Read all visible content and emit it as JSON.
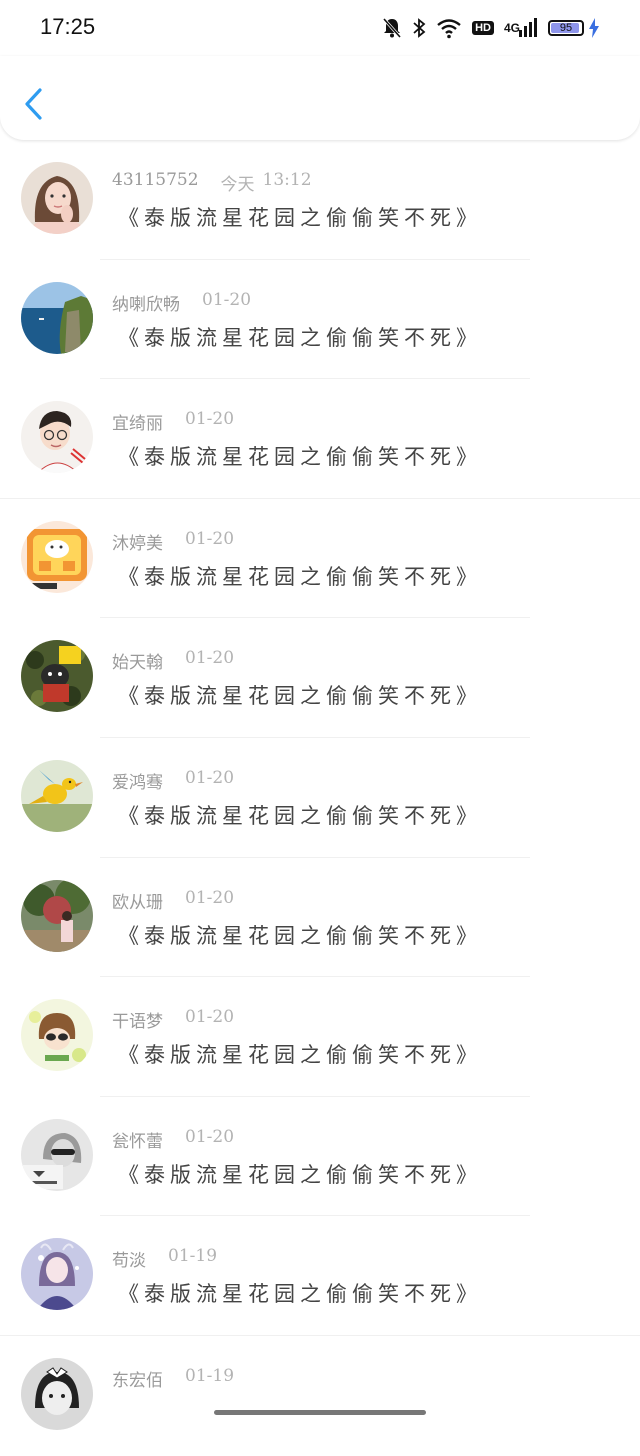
{
  "status": {
    "time": "17:25",
    "network": "4G",
    "hd": "HD",
    "battery": "95"
  },
  "colors": {
    "accent": "#2e9cf0",
    "name": "#9a9a9a",
    "content": "#444444",
    "battery_fill": "#8e95ea"
  },
  "comments": [
    {
      "name": "43115752",
      "date": "今天",
      "time": "13:12",
      "text": "《泰版流星花园之偷偷笑不死》",
      "avatar": "avatar-girl-photo"
    },
    {
      "name": "纳喇欣畅",
      "date": "01-20",
      "time": "",
      "text": "《泰版流星花园之偷偷笑不死》",
      "avatar": "avatar-sea-cliff"
    },
    {
      "name": "宜绮丽",
      "date": "01-20",
      "time": "",
      "text": "《泰版流星花园之偷偷笑不死》",
      "avatar": "avatar-cartoon-boy"
    },
    {
      "name": "沐婷美",
      "date": "01-20",
      "time": "",
      "text": "《泰版流星花园之偷偷笑不死》",
      "avatar": "avatar-orange-sticker"
    },
    {
      "name": "始天翰",
      "date": "01-20",
      "time": "",
      "text": "《泰版流星花园之偷偷笑不死》",
      "avatar": "avatar-camo-character"
    },
    {
      "name": "爱鸿骞",
      "date": "01-20",
      "time": "",
      "text": "《泰版流星花园之偷偷笑不死》",
      "avatar": "avatar-yellow-bird"
    },
    {
      "name": "欧从珊",
      "date": "01-20",
      "time": "",
      "text": "《泰版流星花园之偷偷笑不死》",
      "avatar": "avatar-tree-girl"
    },
    {
      "name": "干语梦",
      "date": "01-20",
      "time": "",
      "text": "《泰版流星花园之偷偷笑不死》",
      "avatar": "avatar-cartoon-girl"
    },
    {
      "name": "瓮怀蕾",
      "date": "01-20",
      "time": "",
      "text": "《泰版流星花园之偷偷笑不死》",
      "avatar": "avatar-bw-photo"
    },
    {
      "name": "苟淡",
      "date": "01-19",
      "time": "",
      "text": "《泰版流星花园之偷偷笑不死》",
      "avatar": "avatar-doll-girl"
    },
    {
      "name": "东宏佰",
      "date": "01-19",
      "time": "",
      "text": "",
      "avatar": "avatar-bw-child"
    }
  ]
}
